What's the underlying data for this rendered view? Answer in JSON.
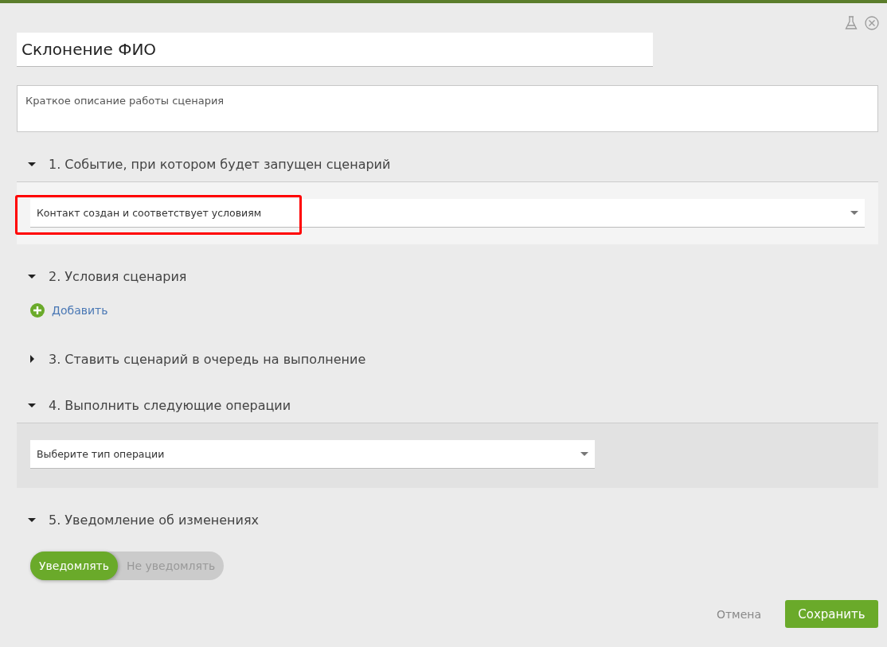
{
  "title_field": {
    "value": "Склонение ФИО"
  },
  "description_field": {
    "placeholder": "Краткое описание работы сценария"
  },
  "sections": [
    {
      "title": "1. Событие, при котором будет запущен сценарий",
      "expanded": true,
      "kind": "select",
      "shaded": false,
      "select": {
        "value": "Контакт создан и соответствует условиям",
        "highlighted": true,
        "wide": true
      }
    },
    {
      "title": "2. Условия сценария",
      "expanded": true,
      "kind": "add",
      "add_label": "Добавить"
    },
    {
      "title": "3. Ставить сценарий в очередь на выполнение",
      "expanded": false
    },
    {
      "title": "4. Выполнить следующие операции",
      "expanded": true,
      "kind": "select",
      "shaded": true,
      "select": {
        "value": "Выберите тип операции",
        "wide": false
      }
    },
    {
      "title": "5. Уведомление об изменениях",
      "expanded": true,
      "kind": "toggle",
      "options": [
        {
          "label": "Уведомлять",
          "selected": true
        },
        {
          "label": "Не уведомлять",
          "selected": false
        }
      ]
    }
  ],
  "buttons": {
    "cancel": "Отмена",
    "save": "Сохранить"
  }
}
